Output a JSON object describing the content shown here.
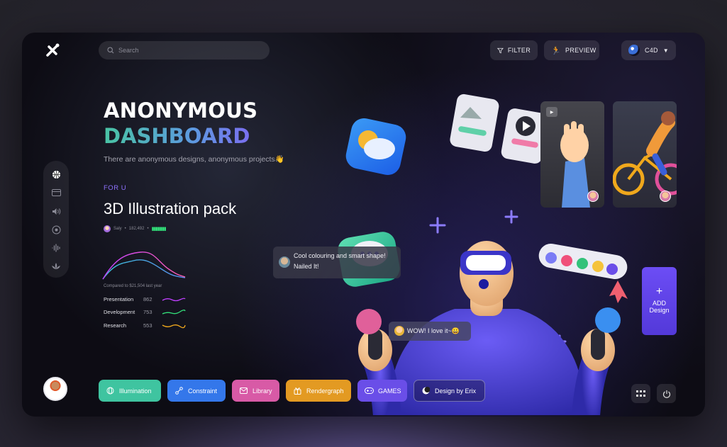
{
  "header": {
    "search_placeholder": "Search",
    "filter_label": "FILTER",
    "preview_label": "PREVIEW",
    "c4d_label": "C4D"
  },
  "sidebar": {
    "icons": [
      "basketball-icon",
      "card-icon",
      "volume-icon",
      "record-icon",
      "waveform-icon",
      "lotus-icon"
    ]
  },
  "hero": {
    "title_line1": "ANONYMOUS",
    "title_line2": "DASHBOARD",
    "subtitle": "There are anonymous designs, anonymous projects👋",
    "tag": "FOR U",
    "pack_title": "3D Illustration pack",
    "author": "Saly",
    "views": "182,492"
  },
  "stats": {
    "compared": "Compared to $21,504 last year",
    "rows": [
      {
        "label": "Presentation",
        "value": "862",
        "color": "#c040ff"
      },
      {
        "label": "Development",
        "value": "753",
        "color": "#33e07a"
      },
      {
        "label": "Research",
        "value": "553",
        "color": "#f0a81c"
      }
    ]
  },
  "comments": {
    "first_line1": "Cool colouring and smart shape!",
    "first_line2": "Nailed It!",
    "second": "WOW!  I love it~😀"
  },
  "add_button": {
    "label_line1": "ADD",
    "label_line2": "Design"
  },
  "chips": [
    {
      "label": "Illumination",
      "color": "#3fc4a0",
      "icon": "globe-icon"
    },
    {
      "label": "Constraint",
      "color": "#3477ea",
      "icon": "nodes-icon"
    },
    {
      "label": "Library",
      "color": "#d85aa6",
      "icon": "mail-icon"
    },
    {
      "label": "Rendergraph",
      "color": "#e39a22",
      "icon": "gift-icon"
    },
    {
      "label": "GAMES",
      "color": "#6a4ee8",
      "icon": "gamepad-icon"
    },
    {
      "label": "Design by Erix",
      "color": "transparent",
      "icon": "moon-icon"
    }
  ]
}
